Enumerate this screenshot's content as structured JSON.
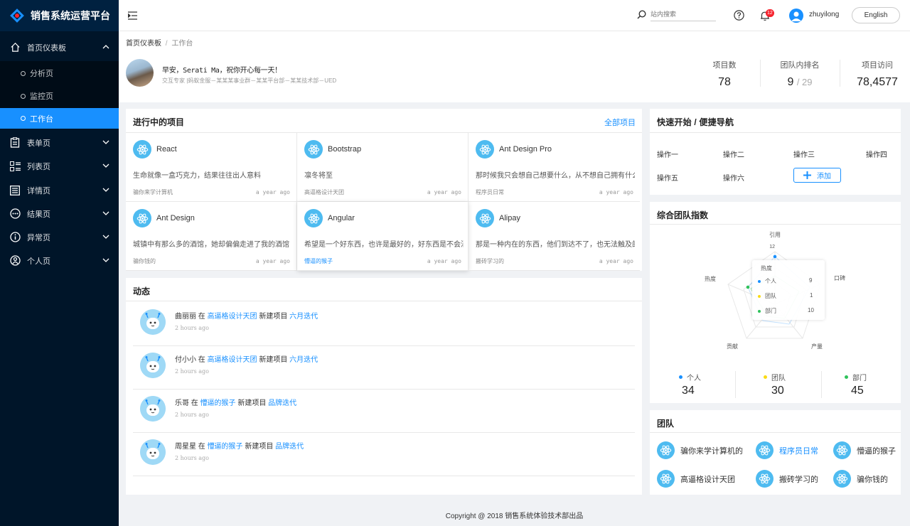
{
  "app": {
    "title": "销售系统运营平台"
  },
  "sidebar": {
    "items": [
      {
        "label": "首页仪表板",
        "icon": "home-icon"
      },
      {
        "label": "表单页",
        "icon": "form-icon"
      },
      {
        "label": "列表页",
        "icon": "table-icon"
      },
      {
        "label": "详情页",
        "icon": "profile-icon"
      },
      {
        "label": "结果页",
        "icon": "result-icon"
      },
      {
        "label": "异常页",
        "icon": "warning-icon"
      },
      {
        "label": "个人页",
        "icon": "user-icon"
      }
    ],
    "sub_items": [
      "分析页",
      "监控页",
      "工作台"
    ]
  },
  "header": {
    "search_placeholder": "站内搜索",
    "notification_count": "12",
    "username": "zhuyilong",
    "lang_button": "English"
  },
  "breadcrumb": {
    "home": "首页仪表板",
    "sep": "/",
    "current": "工作台"
  },
  "welcome": {
    "greeting": "早安，Serati Ma，祝你开心每一天！",
    "role": "交互专家 |蚂蚁金服－某某某事业群－某某平台部－某某技术部－UED"
  },
  "stats": {
    "projects_label": "项目数",
    "projects_value": "78",
    "rank_label": "团队内排名",
    "rank_value": "9",
    "rank_total": "/ 29",
    "visits_label": "项目访问",
    "visits_value": "78,4577"
  },
  "projects": {
    "title": "进行中的项目",
    "all_link": "全部项目",
    "items": [
      {
        "name": "React",
        "desc": "生命就像一盒巧克力，结果往往出人意料",
        "member": "骗你来学计算机",
        "time": "a year ago"
      },
      {
        "name": "Bootstrap",
        "desc": "凛冬将至",
        "member": "高逼格设计天团",
        "time": "a year ago"
      },
      {
        "name": "Ant Design Pro",
        "desc": "那时候我只会想自己想要什么，从不想自己拥有什么",
        "member": "程序员日常",
        "time": "a year ago"
      },
      {
        "name": "Ant Design",
        "desc": "城镇中有那么多的酒馆，她却偏偏走进了我的酒馆",
        "member": "骗你钱的",
        "time": "a year ago"
      },
      {
        "name": "Angular",
        "desc": "希望是一个好东西，也许是最好的，好东西是不会消亡的",
        "member": "懵逼的猴子",
        "time": "a year ago"
      },
      {
        "name": "Alipay",
        "desc": "那是一种内在的东西，他们到达不了，也无法触及的",
        "member": "搬砖学习的",
        "time": "a year ago"
      }
    ]
  },
  "activity": {
    "title": "动态",
    "items": [
      {
        "user": "曲丽丽",
        "at": "在",
        "group": "高逼格设计天团",
        "action": "新建项目",
        "project": "六月迭代",
        "time": "2 hours ago"
      },
      {
        "user": "付小小",
        "at": "在",
        "group": "高逼格设计天团",
        "action": "新建项目",
        "project": "六月迭代",
        "time": "2 hours ago"
      },
      {
        "user": "乐哥",
        "at": "在",
        "group": "懵逼的猴子",
        "action": "新建项目",
        "project": "品牌迭代",
        "time": "2 hours ago"
      },
      {
        "user": "周星星",
        "at": "在",
        "group": "懵逼的猴子",
        "action": "新建项目",
        "project": "品牌迭代",
        "time": "2 hours ago"
      }
    ]
  },
  "quick": {
    "title": "快速开始 / 便捷导航",
    "links": [
      "操作一",
      "操作二",
      "操作三",
      "操作四",
      "操作五",
      "操作六"
    ],
    "add_label": "添加"
  },
  "radar": {
    "title": "综合团队指数",
    "axes": [
      "引用",
      "口碑",
      "产量",
      "贡献",
      "热度"
    ],
    "scale_value": "12",
    "tooltip": {
      "title": "热度",
      "rows": [
        {
          "name": "个人",
          "value": "9"
        },
        {
          "name": "团队",
          "value": "1"
        },
        {
          "name": "部门",
          "value": "10"
        }
      ]
    },
    "legend": [
      {
        "name": "个人",
        "value": "34",
        "color": "#1890ff"
      },
      {
        "name": "团队",
        "value": "30",
        "color": "#fadb14"
      },
      {
        "name": "部门",
        "value": "45",
        "color": "#2fc25b"
      }
    ]
  },
  "team": {
    "title": "团队",
    "items": [
      "骗你来学计算机的",
      "程序员日常",
      "懵逼的猴子",
      "高逼格设计天团",
      "搬砖学习的",
      "骗你钱的"
    ]
  },
  "footer": {
    "copyright": "Copyright @ 2018 销售系统体验技术部出品"
  }
}
